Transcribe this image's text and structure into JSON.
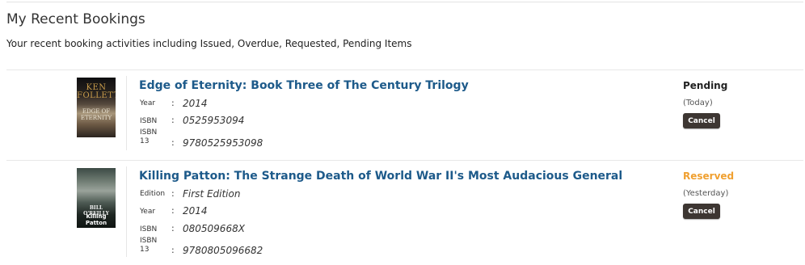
{
  "page": {
    "title": "My Recent Bookings",
    "subtitle": "Your recent booking activities including Issued, Overdue, Requested, Pending Items"
  },
  "bookings": [
    {
      "title": "Edge of Eternity: Book Three of The Century Trilogy",
      "cover": {
        "author_text": "KEN FOLLETT",
        "title_text": "EDGE OF ETERNITY"
      },
      "fields": [
        {
          "label": "Year",
          "value": "2014"
        },
        {
          "label": "ISBN",
          "value": "0525953094"
        },
        {
          "label": "ISBN 13",
          "value": "9780525953098"
        }
      ],
      "status": "Pending",
      "status_color": "#222222",
      "status_when": "(Today)",
      "cancel_label": "Cancel"
    },
    {
      "title": "Killing Patton: The Strange Death of World War II's Most Audacious General",
      "cover": {
        "author_text": "BILL O'REILLY",
        "title_text": "Killing Patton"
      },
      "fields": [
        {
          "label": "Edition",
          "value": "First Edition"
        },
        {
          "label": "Year",
          "value": "2014"
        },
        {
          "label": "ISBN",
          "value": "080509668X"
        },
        {
          "label": "ISBN 13",
          "value": "9780805096682"
        }
      ],
      "status": "Reserved",
      "status_color": "#f0a030",
      "status_when": "(Yesterday)",
      "cancel_label": "Cancel"
    }
  ],
  "colors": {
    "link": "#1d5a8a",
    "button": "#3d3632"
  }
}
